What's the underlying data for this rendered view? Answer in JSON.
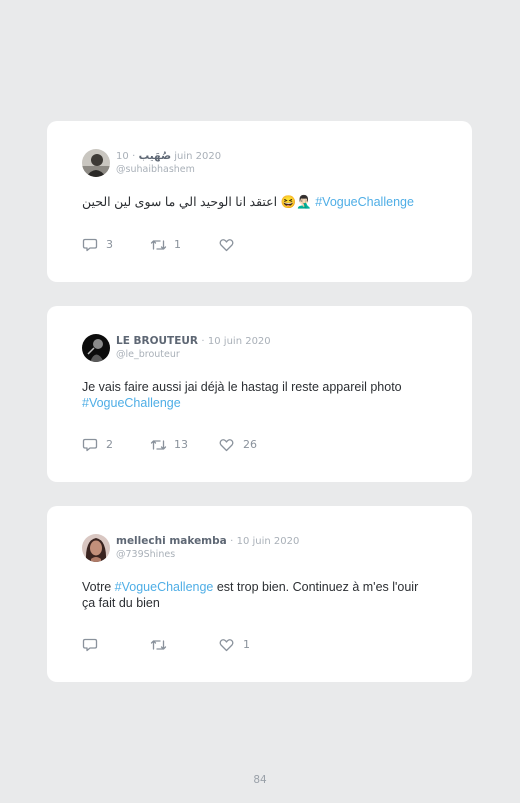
{
  "tweets": [
    {
      "name": "صُهَيب",
      "date": "10 juin 2020",
      "handle": "@suhaibhashem",
      "text_before": "اعتقد انا الوحيد الي ما سوى لين الحين 😆🤦🏻‍♂️",
      "hashtag": "#VogueChallenge",
      "text_after": "",
      "replies": "3",
      "retweets": "1",
      "likes": ""
    },
    {
      "name": "LE BROUTEUR",
      "date": "10 juin 2020",
      "handle": "@le_brouteur",
      "text_before": "Je vais faire aussi jai déjà le hastag il reste appareil photo ",
      "hashtag": "#VogueChallenge",
      "text_after": "",
      "replies": "2",
      "retweets": "13",
      "likes": "26"
    },
    {
      "name": "mellechi makemba",
      "date": "10 juin 2020",
      "handle": "@739Shines",
      "text_before": "Votre ",
      "hashtag": "#VogueChallenge",
      "text_after": " est trop bien. Continuez à m'es l'ouir ça fait du bien",
      "replies": "",
      "retweets": "",
      "likes": "1"
    }
  ],
  "separator": "·",
  "page_number": "84",
  "colors": {
    "background": "#e9eaeb",
    "card": "#ffffff",
    "hashtag": "#4faee6"
  },
  "icons": [
    "reply-icon",
    "retweet-icon",
    "like-icon"
  ]
}
